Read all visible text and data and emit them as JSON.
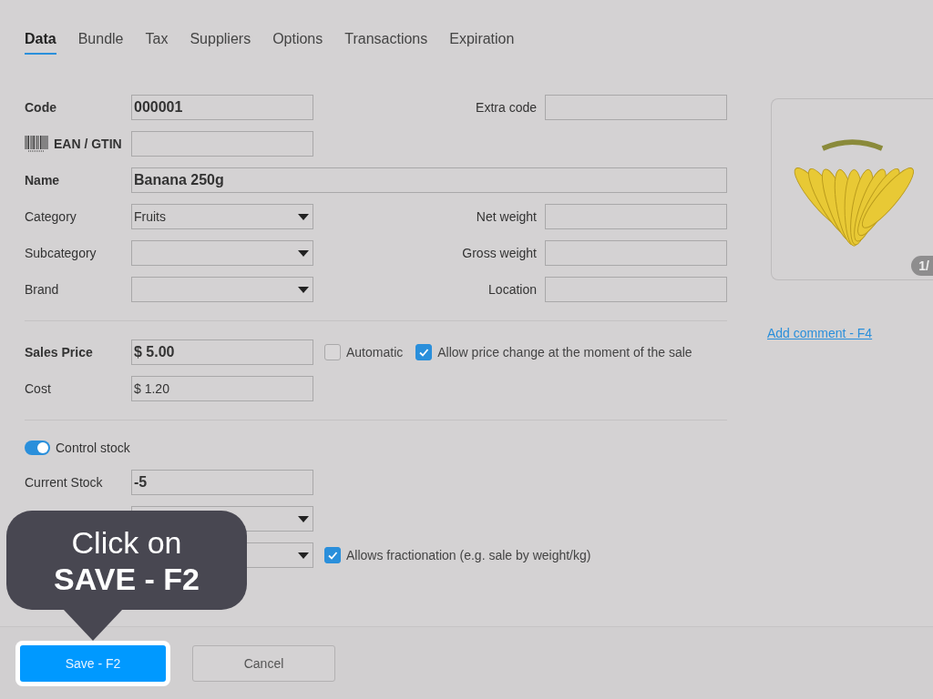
{
  "tabs": [
    {
      "label": "Data",
      "selected": true
    },
    {
      "label": "Bundle",
      "selected": false
    },
    {
      "label": "Tax",
      "selected": false
    },
    {
      "label": "Suppliers",
      "selected": false
    },
    {
      "label": "Options",
      "selected": false
    },
    {
      "label": "Transactions",
      "selected": false
    },
    {
      "label": "Expiration",
      "selected": false
    }
  ],
  "sections": [
    {
      "rows": [
        {
          "kind": "standard",
          "label": "Code",
          "strong": true,
          "field": {
            "kind": "text",
            "value": "000001",
            "strong": true
          },
          "side": {
            "label": "Extra code",
            "field": {
              "kind": "text"
            }
          }
        },
        {
          "kind": "barcode",
          "label": "EAN / GTIN",
          "strong": true,
          "field": {
            "kind": "text"
          }
        },
        {
          "kind": "wide",
          "label": "Name",
          "strong": true,
          "field": {
            "kind": "text",
            "value": "Banana 250g",
            "strong": true
          }
        },
        {
          "kind": "standard",
          "label": "Category",
          "strong": false,
          "field": {
            "kind": "select",
            "value": "Fruits",
            "strong": false
          },
          "side": {
            "label": "Net weight",
            "field": {
              "kind": "text"
            }
          }
        },
        {
          "kind": "standard",
          "label": "Subcategory",
          "strong": false,
          "field": {
            "kind": "select"
          },
          "side": {
            "label": "Gross weight",
            "field": {
              "kind": "text"
            }
          }
        },
        {
          "kind": "standard",
          "label": "Brand",
          "strong": false,
          "field": {
            "kind": "select"
          },
          "side": {
            "label": "Location",
            "field": {
              "kind": "text"
            }
          }
        }
      ]
    },
    {
      "rows": [
        {
          "kind": "standard",
          "label": "Sales Price",
          "strong": true,
          "field": {
            "kind": "text",
            "value": "$ 5.00",
            "strong": true
          },
          "options": [
            {
              "label": "Automatic",
              "checked": false
            },
            {
              "label": "Allow price change at the moment of the sale",
              "checked": true
            }
          ]
        },
        {
          "kind": "standard",
          "label": "Cost",
          "strong": false,
          "field": {
            "kind": "text",
            "value": "$ 1.20",
            "strong": false
          }
        }
      ]
    },
    {
      "toggle": {
        "label": "Control stock",
        "on": true
      },
      "rows": [
        {
          "kind": "standard",
          "label": "Current Stock",
          "strong": false,
          "field": {
            "kind": "text",
            "value": "-5",
            "strong": true
          }
        },
        {
          "kind": "standard",
          "field": {
            "kind": "select"
          }
        },
        {
          "kind": "standard",
          "field": {
            "kind": "select"
          },
          "options": [
            {
              "label": "Allows fractionation (e.g. sale by weight/kg)",
              "checked": true
            }
          ]
        }
      ]
    }
  ],
  "image_panel": {
    "counter": "1/",
    "link": "Add comment - F4"
  },
  "buttons": [
    {
      "label": "Save - F2",
      "kind": "primary"
    },
    {
      "label": "Cancel",
      "kind": "secondary"
    }
  ],
  "callout": {
    "lines": [
      "Click on",
      "SAVE - F2"
    ]
  }
}
